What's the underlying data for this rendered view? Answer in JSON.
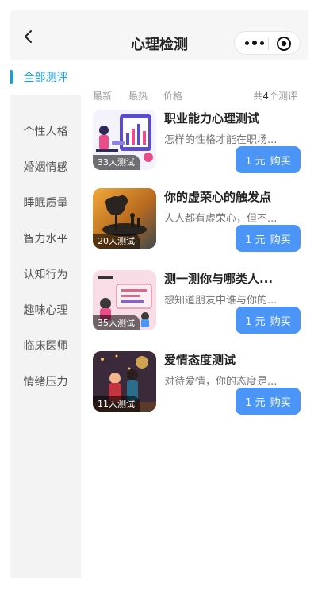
{
  "header": {
    "title": "心理检测"
  },
  "sidebar": {
    "items": [
      {
        "label": "全部测评"
      },
      {
        "label": "个性人格"
      },
      {
        "label": "婚姻情感"
      },
      {
        "label": "睡眠质量"
      },
      {
        "label": "智力水平"
      },
      {
        "label": "认知行为"
      },
      {
        "label": "趣味心理"
      },
      {
        "label": "临床医师"
      },
      {
        "label": "情绪压力"
      }
    ]
  },
  "sort": {
    "latest": "最新",
    "hottest": "最热",
    "price": "价格",
    "total_prefix": "共",
    "total_count": "4",
    "total_suffix": "个测评"
  },
  "list": [
    {
      "title": "职业能力心理测试",
      "desc": "怎样的性格才能在职场...",
      "count": "33人测试",
      "price": "1 元",
      "buy": "购买"
    },
    {
      "title": "你的虚荣心的触发点",
      "desc": "人人都有虚荣心，但不...",
      "count": "20人测试",
      "price": "1 元",
      "buy": "购买"
    },
    {
      "title": "测一测你与哪类人...",
      "desc": "想知道朋友中谁与你的...",
      "count": "35人测试",
      "price": "1 元",
      "buy": "购买"
    },
    {
      "title": "爱情态度测试",
      "desc": "对待爱情，你的态度是...",
      "count": "11人测试",
      "price": "1 元",
      "buy": "购买"
    }
  ],
  "colors": {
    "accent": "#1a9ed9",
    "button": "#4a95f5"
  }
}
